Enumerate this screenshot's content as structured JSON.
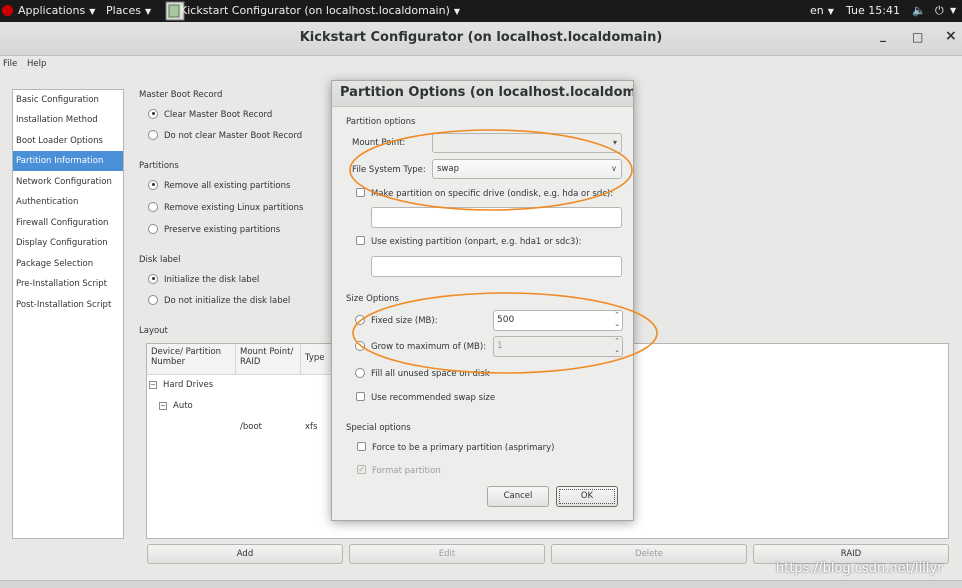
{
  "topbar": {
    "applications": "Applications",
    "places": "Places",
    "window": "Kickstart Configurator (on localhost.localdomain)",
    "lang": "en",
    "clock": "Tue 15:41"
  },
  "window": {
    "title": "Kickstart Configurator (on localhost.localdomain)",
    "minimize": "_",
    "maximize": "□",
    "close": "×"
  },
  "menubar": {
    "file": "File",
    "help": "Help"
  },
  "nav": {
    "items": [
      "Basic Configuration",
      "Installation Method",
      "Boot Loader Options",
      "Partition Information",
      "Network Configuration",
      "Authentication",
      "Firewall Configuration",
      "Display Configuration",
      "Package Selection",
      "Pre-Installation Script",
      "Post-Installation Script"
    ],
    "selected_index": 3
  },
  "main": {
    "mbr": {
      "title": "Master Boot Record",
      "opt1": "Clear Master Boot Record",
      "opt2": "Do not clear Master Boot Record"
    },
    "partitions": {
      "title": "Partitions",
      "opt1": "Remove all existing partitions",
      "opt2": "Remove existing Linux partitions",
      "opt3": "Preserve existing partitions"
    },
    "disk_label": {
      "title": "Disk label",
      "opt1": "Initialize the disk label",
      "opt2": "Do not initialize the disk label"
    },
    "layout": {
      "title": "Layout",
      "col_device": "Device/ Partition Number",
      "col_mount": "Mount Point/ RAID",
      "col_type": "Type",
      "hard_drives": "Hard Drives",
      "auto": "Auto",
      "row_mount": "/boot",
      "row_type": "xfs"
    },
    "buttons": {
      "add": "Add",
      "edit": "Edit",
      "delete": "Delete",
      "raid": "RAID"
    }
  },
  "dialog": {
    "title": "Partition Options (on localhost.localdoma...",
    "partition_options": "Partition options",
    "mount_point_label": "Mount Point:",
    "mount_point_value": "",
    "fs_type_label": "File System Type:",
    "fs_type_value": "swap",
    "ondisk_label": "Make partition on specific drive (ondisk, e.g. hda or sdc):",
    "onpart_label": "Use existing partition (onpart, e.g. hda1 or sdc3):",
    "size_options": "Size Options",
    "fixed_label": "Fixed size (MB):",
    "fixed_value": "500",
    "grow_label": "Grow to maximum of (MB):",
    "grow_value": "1",
    "fill_label": "Fill all unused space on disk",
    "recommended_label": "Use recommended swap size",
    "special_options": "Special options",
    "primary_label": "Force to be a primary partition (asprimary)",
    "format_label": "Format partition",
    "cancel": "Cancel",
    "ok": "OK"
  },
  "watermark": "https://blog.csdn.net/lillyr",
  "annotation_color": "#f08a24"
}
